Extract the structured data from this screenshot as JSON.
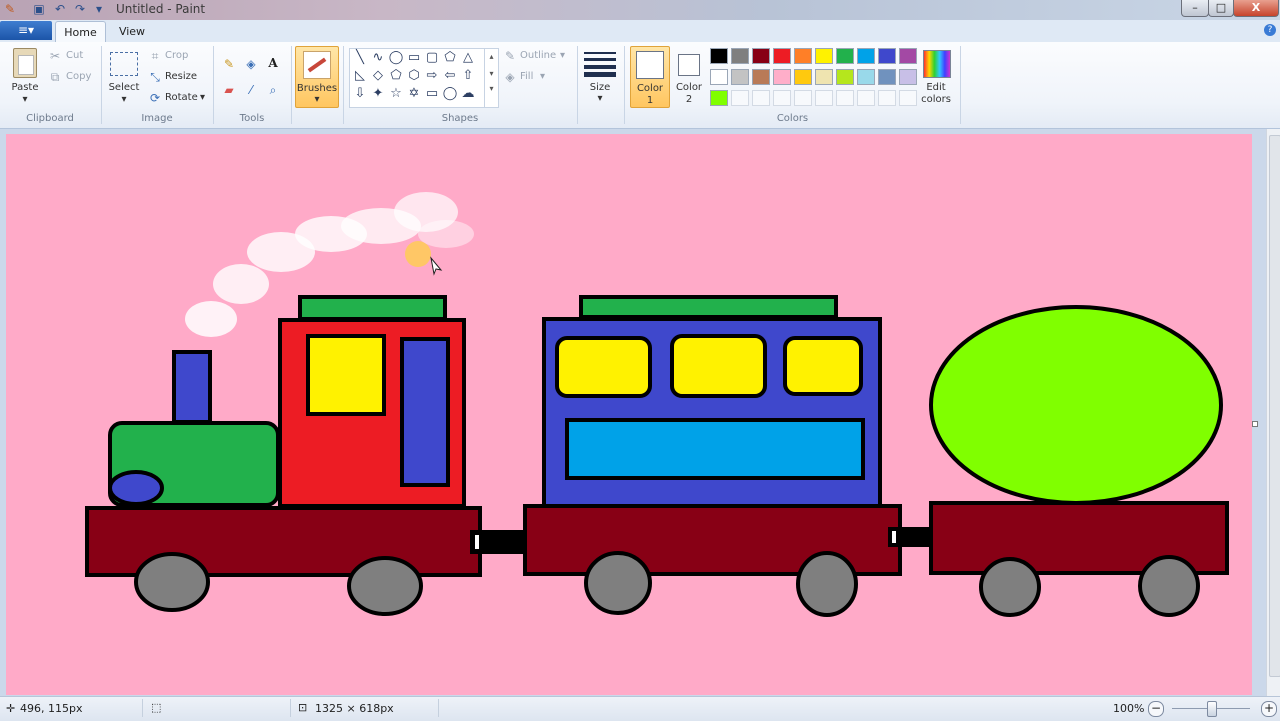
{
  "window": {
    "title": "Untitled - Paint"
  },
  "quick_access": {
    "icons": [
      "paint-icon",
      "save-icon",
      "undo-icon",
      "redo-icon",
      "customize-icon"
    ]
  },
  "window_controls": {
    "minimize": "–",
    "maximize": "□",
    "close": "X"
  },
  "tabs": {
    "file_icon": "≡▾",
    "home": "Home",
    "view": "View"
  },
  "ribbon": {
    "clipboard": {
      "paste": "Paste",
      "cut": "Cut",
      "copy": "Copy",
      "label": "Clipboard"
    },
    "image": {
      "select": "Select",
      "crop": "Crop",
      "resize": "Resize",
      "rotate": "Rotate",
      "label": "Image"
    },
    "tools": {
      "label": "Tools"
    },
    "brushes": {
      "label": "Brushes"
    },
    "shapes": {
      "outline": "Outline",
      "fill": "Fill",
      "label": "Shapes"
    },
    "size": {
      "label": "Size"
    },
    "color1": {
      "label_line1": "Color",
      "label_line2": "1",
      "value": "#ffffff"
    },
    "color2": {
      "label_line1": "Color",
      "label_line2": "2",
      "value": "#ffffff"
    },
    "colors": {
      "label": "Colors",
      "row1": [
        "#000000",
        "#7f7f7f",
        "#880015",
        "#ed1c24",
        "#ff7f27",
        "#fff200",
        "#22b14c",
        "#00a2e8",
        "#3f48cc",
        "#a349a4"
      ],
      "row2": [
        "#ffffff",
        "#c3c3c3",
        "#b97a57",
        "#ffaec9",
        "#ffc90e",
        "#efe4b0",
        "#b5e61d",
        "#99d9ea",
        "#7092be",
        "#c8bfe7"
      ],
      "row3": [
        "#80ff00",
        "",
        "",
        "",
        "",
        "",
        "",
        "",
        "",
        ""
      ]
    },
    "edit_colors": {
      "line1": "Edit",
      "line2": "colors"
    }
  },
  "canvas": {
    "background": "#ffaac8"
  },
  "status": {
    "cursor_pos": "496, 115px",
    "canvas_size": "1325 × 618px",
    "zoom": "100%",
    "zoom_level": 0.5
  }
}
